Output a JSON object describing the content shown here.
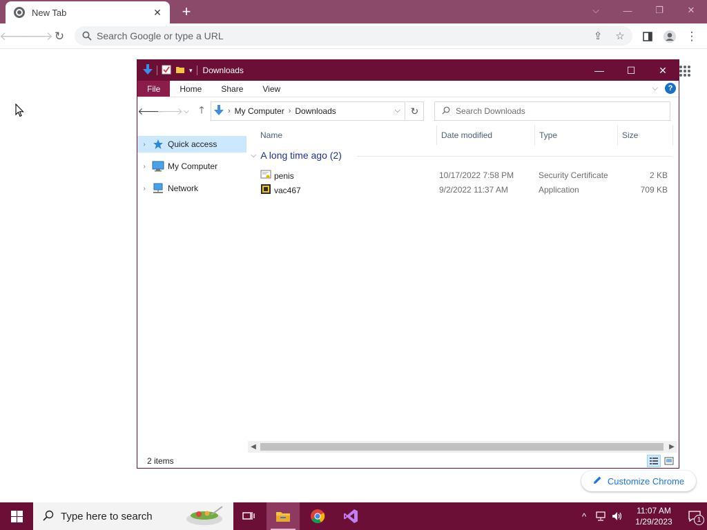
{
  "chrome": {
    "tab_title": "New Tab",
    "omnibox_placeholder": "Search Google or type a URL",
    "customize_label": "Customize Chrome"
  },
  "explorer": {
    "title": "Downloads",
    "ribbon_tabs": [
      "File",
      "Home",
      "Share",
      "View"
    ],
    "breadcrumb": [
      "My Computer",
      "Downloads"
    ],
    "search_placeholder": "Search Downloads",
    "nav_items": [
      "Quick access",
      "My Computer",
      "Network"
    ],
    "columns": [
      "Name",
      "Date modified",
      "Type",
      "Size"
    ],
    "group_label": "A long time ago (2)",
    "files": [
      {
        "name": "penis",
        "date": "10/17/2022 7:58 PM",
        "type": "Security Certificate",
        "size": "2 KB"
      },
      {
        "name": "vac467",
        "date": "9/2/2022 11:37 AM",
        "type": "Application",
        "size": "709 KB"
      }
    ],
    "status": "2 items"
  },
  "taskbar": {
    "search_placeholder": "Type here to search",
    "time": "11:07 AM",
    "date": "1/29/2023",
    "notification_count": "1"
  },
  "colors": {
    "accent": "#6b0f36",
    "chrome_frame": "#8c4a6b",
    "file_tab": "#8c1d4a",
    "selection": "#cce8ff"
  }
}
